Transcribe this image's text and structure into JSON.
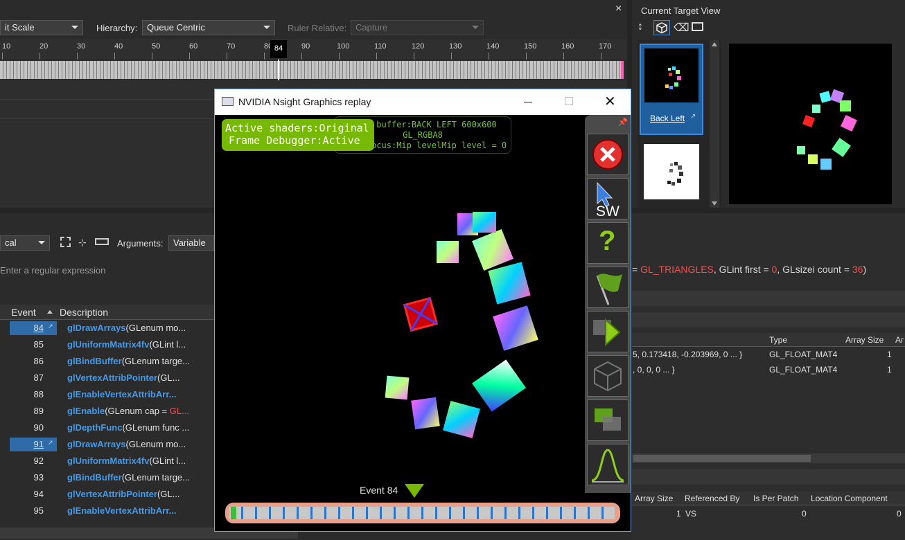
{
  "toolbar": {
    "scale_value": "it Scale",
    "hierarchy_label": "Hierarchy:",
    "hierarchy_value": "Queue Centric",
    "ruler_label": "Ruler Relative:",
    "ruler_value": "Capture",
    "close": "×"
  },
  "ruler": {
    "ticks": [
      "10",
      "20",
      "30",
      "40",
      "50",
      "60",
      "70",
      "80",
      "90",
      "100",
      "110",
      "120",
      "130",
      "140",
      "150",
      "160",
      "170"
    ],
    "current": "84"
  },
  "events_panel": {
    "filter_value": "cal",
    "arguments_label": "Arguments:",
    "arguments_value": "Variable +",
    "search_placeholder": "Enter a regular expression",
    "col_event": "Event",
    "col_description": "Description",
    "rows": [
      {
        "num": "84",
        "fn": "glDrawArrays",
        "rest": "(GLenum mo...",
        "selected": true
      },
      {
        "num": "85",
        "fn": "glUniformMatrix4fv",
        "rest": "(GLint l...",
        "selected": false
      },
      {
        "num": "86",
        "fn": "glBindBuffer",
        "rest": "(GLenum targe...",
        "selected": false
      },
      {
        "num": "87",
        "fn": "glVertexAttribPointer",
        "rest": "(GL...",
        "selected": false
      },
      {
        "num": "88",
        "fn": "glEnableVertexAttribArr...",
        "rest": "",
        "selected": false
      },
      {
        "num": "89",
        "fn": "glEnable",
        "rest": "(GLenum cap = ",
        "red": "GL...",
        "selected": false
      },
      {
        "num": "90",
        "fn": "glDepthFunc",
        "rest": "(GLenum func ...",
        "selected": false
      },
      {
        "num": "91",
        "fn": "glDrawArrays",
        "rest": "(GLenum mo...",
        "selected": true
      },
      {
        "num": "92",
        "fn": "glUniformMatrix4fv",
        "rest": "(GLint l...",
        "selected": false
      },
      {
        "num": "93",
        "fn": "glBindBuffer",
        "rest": "(GLenum targe...",
        "selected": false
      },
      {
        "num": "94",
        "fn": "glVertexAttribPointer",
        "rest": "(GL...",
        "selected": false
      },
      {
        "num": "95",
        "fn": "glEnableVertexAttribArr...",
        "rest": "",
        "selected": false
      }
    ]
  },
  "target_view": {
    "title": "Current Target View",
    "thumb_label": "Back Left"
  },
  "api_call": {
    "prefix": "= ",
    "mode": "GL_TRIANGLES",
    "mid1": ", GLint first = ",
    "first": "0",
    "mid2": ", GLsizei count = ",
    "count": "36",
    "suffix": ")"
  },
  "uniforms": {
    "headers": [
      "Type",
      "Array Size",
      "Ar"
    ],
    "rows": [
      {
        "value": "5, 0.173418, -0.203969, 0 ... }",
        "type": "GL_FLOAT_MAT4",
        "size": "1"
      },
      {
        "value": ", 0, 0, 0 ... }",
        "type": "GL_FLOAT_MAT4",
        "size": "1"
      }
    ]
  },
  "attributes": {
    "headers": [
      "Array Size",
      "Referenced By",
      "Is Per Patch",
      "Location Component"
    ],
    "row": {
      "size": "1",
      "ref": "VS",
      "patch": "0",
      "loc": "0"
    }
  },
  "replay": {
    "title": "NVIDIA Nsight Graphics replay",
    "hud_line1": "Active shaders:Original",
    "hud_line2": "Frame Debugger:Active",
    "info_line1": "buffer:BACK LEFT 600x600",
    "info_line2": "GL_RGBA8",
    "info_line3": "Focus:Mip levelMip level = 0",
    "sw_label": "SW",
    "event_label": "Event 84"
  },
  "colors": {
    "accent_blue": "#2e6ba8",
    "fn_blue": "#3f9bf0",
    "nv_green": "#76b900",
    "red_value": "#ff4b4b"
  }
}
